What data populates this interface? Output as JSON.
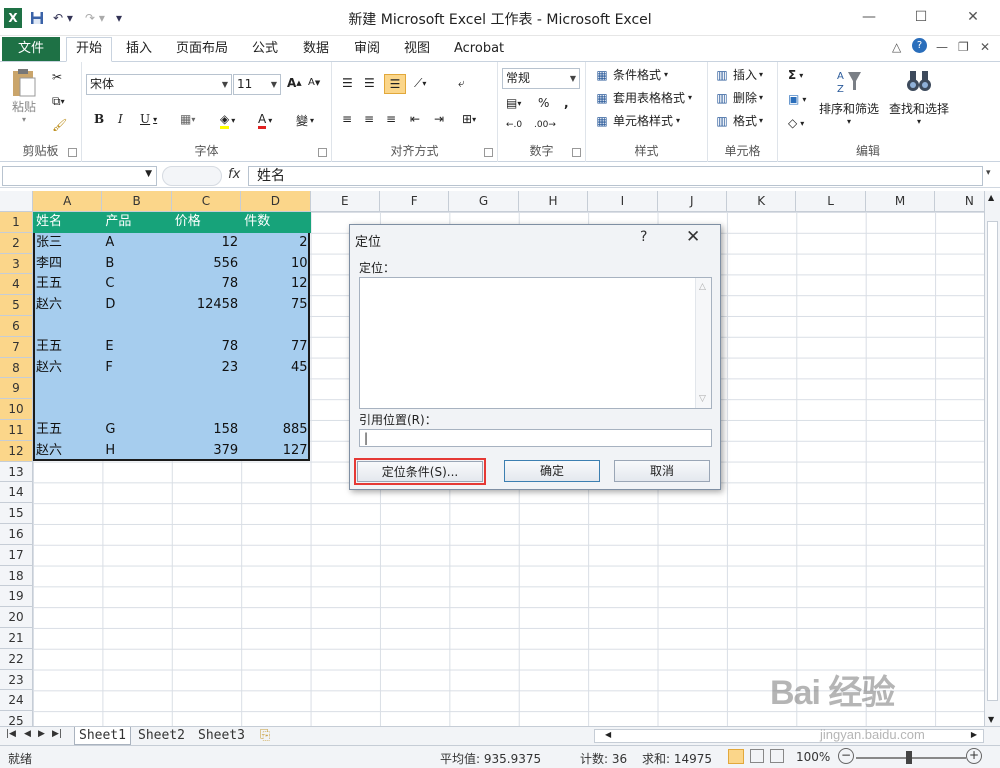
{
  "window": {
    "title": "新建 Microsoft Excel 工作表 - Microsoft Excel",
    "excel_logo": "X"
  },
  "ribbon_tabs": [
    "文件",
    "开始",
    "插入",
    "页面布局",
    "公式",
    "数据",
    "审阅",
    "视图",
    "Acrobat"
  ],
  "ribbon": {
    "clipboard": {
      "paste": "粘贴",
      "label": "剪贴板"
    },
    "font": {
      "name": "宋体",
      "size": "11",
      "label": "字体",
      "bold": "B",
      "italic": "I",
      "underline": "U",
      "grow": "A",
      "shrink": "A",
      "phonetic": "變",
      "color_a": "A"
    },
    "alignment": {
      "label": "对齐方式"
    },
    "number": {
      "format": "常规",
      "label": "数字",
      "percent": "%",
      "comma": ",",
      "inc": ".0",
      "dec": ".00"
    },
    "styles": {
      "conditional": "条件格式",
      "table": "套用表格格式",
      "cell": "单元格样式",
      "label": "样式"
    },
    "cells": {
      "insert": "插入",
      "delete": "删除",
      "format": "格式",
      "label": "单元格"
    },
    "editing": {
      "sort": "排序和筛选",
      "find": "查找和选择",
      "label": "编辑",
      "sigma": "Σ"
    }
  },
  "formula_bar": {
    "fx": "fx",
    "value": "姓名"
  },
  "columns": [
    "A",
    "B",
    "C",
    "D",
    "E",
    "F",
    "G",
    "H",
    "I",
    "J",
    "K",
    "L",
    "M",
    "N"
  ],
  "rows": [
    "1",
    "2",
    "3",
    "4",
    "5",
    "6",
    "7",
    "8",
    "9",
    "10",
    "11",
    "12",
    "13",
    "14",
    "15",
    "16",
    "17",
    "18",
    "19",
    "20",
    "21",
    "22",
    "23",
    "24",
    "25"
  ],
  "sheet": {
    "headers": [
      "姓名",
      "产品",
      "价格",
      "件数"
    ],
    "data": [
      [
        "张三",
        "A",
        "12",
        "2"
      ],
      [
        "李四",
        "B",
        "556",
        "10"
      ],
      [
        "王五",
        "C",
        "78",
        "12"
      ],
      [
        "赵六",
        "D",
        "12458",
        "75"
      ],
      [
        "",
        "",
        "",
        ""
      ],
      [
        "王五",
        "E",
        "78",
        "77"
      ],
      [
        "赵六",
        "F",
        "23",
        "45"
      ],
      [
        "",
        "",
        "",
        ""
      ],
      [
        "",
        "",
        "",
        ""
      ],
      [
        "王五",
        "G",
        "158",
        "885"
      ],
      [
        "赵六",
        "H",
        "379",
        "127"
      ]
    ]
  },
  "dialog": {
    "title": "定位",
    "help": "?",
    "close": "✕",
    "goto_label": "定位：",
    "ref_label": "引用位置(R)：",
    "ref_value": "|",
    "special_button": "定位条件(S)...",
    "ok_button": "确定",
    "cancel_button": "取消"
  },
  "sheet_tabs": [
    "Sheet1",
    "Sheet2",
    "Sheet3"
  ],
  "status": {
    "ready": "就绪",
    "average": "平均值: 935.9375",
    "count": "计数: 36",
    "sum": "求和: 14975",
    "zoom": "100%"
  },
  "watermark": {
    "logo": "Bai 经验",
    "url": "jingyan.baidu.com"
  },
  "colors": {
    "excel_green": "#1e7145",
    "header_fill": "#17a37a",
    "selection": "#a6cdee",
    "highlight_border": "#e53935",
    "selected_header": "#fbd68a"
  }
}
